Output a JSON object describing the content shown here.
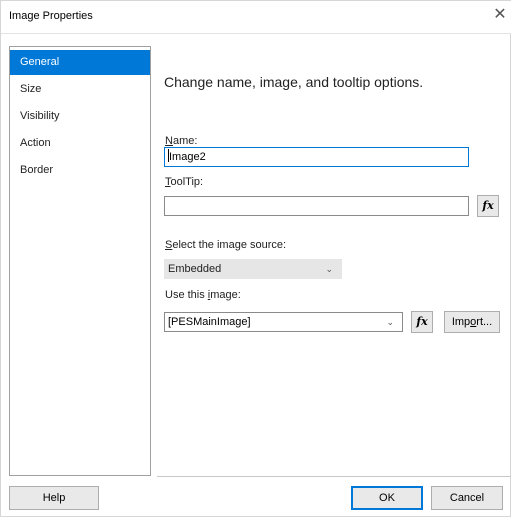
{
  "window": {
    "title": "Image Properties",
    "close_glyph": "✕"
  },
  "nav": {
    "items": [
      {
        "label": "General",
        "selected": true
      },
      {
        "label": "Size",
        "selected": false
      },
      {
        "label": "Visibility",
        "selected": false
      },
      {
        "label": "Action",
        "selected": false
      },
      {
        "label": "Border",
        "selected": false
      }
    ]
  },
  "general": {
    "heading": "Change name, image, and tooltip options.",
    "name_label_accel": "N",
    "name_label_rest": "ame:",
    "name_value": "Image2",
    "tooltip_label_accel": "T",
    "tooltip_label_rest": "oolTip:",
    "tooltip_value": "",
    "fx_glyph": "fx",
    "source_label_accel": "S",
    "source_label_rest": "elect the image source:",
    "source_value": "Embedded",
    "image_label_pre": "Use this ",
    "image_label_accel": "i",
    "image_label_rest": "mage:",
    "image_value": "[PESMainImage]",
    "import_label_pre": "Imp",
    "import_label_accel": "o",
    "import_label_rest": "rt..."
  },
  "footer": {
    "help_label": "Help",
    "ok_label": "OK",
    "cancel_label": "Cancel"
  },
  "colors": {
    "accent": "#0078d7",
    "button_bg": "#e9e9e9",
    "combo_disabled_bg": "#e6e6e6"
  },
  "icons": {
    "chevron": "chevron-down-icon",
    "close": "close-icon",
    "fx": "function-icon"
  }
}
